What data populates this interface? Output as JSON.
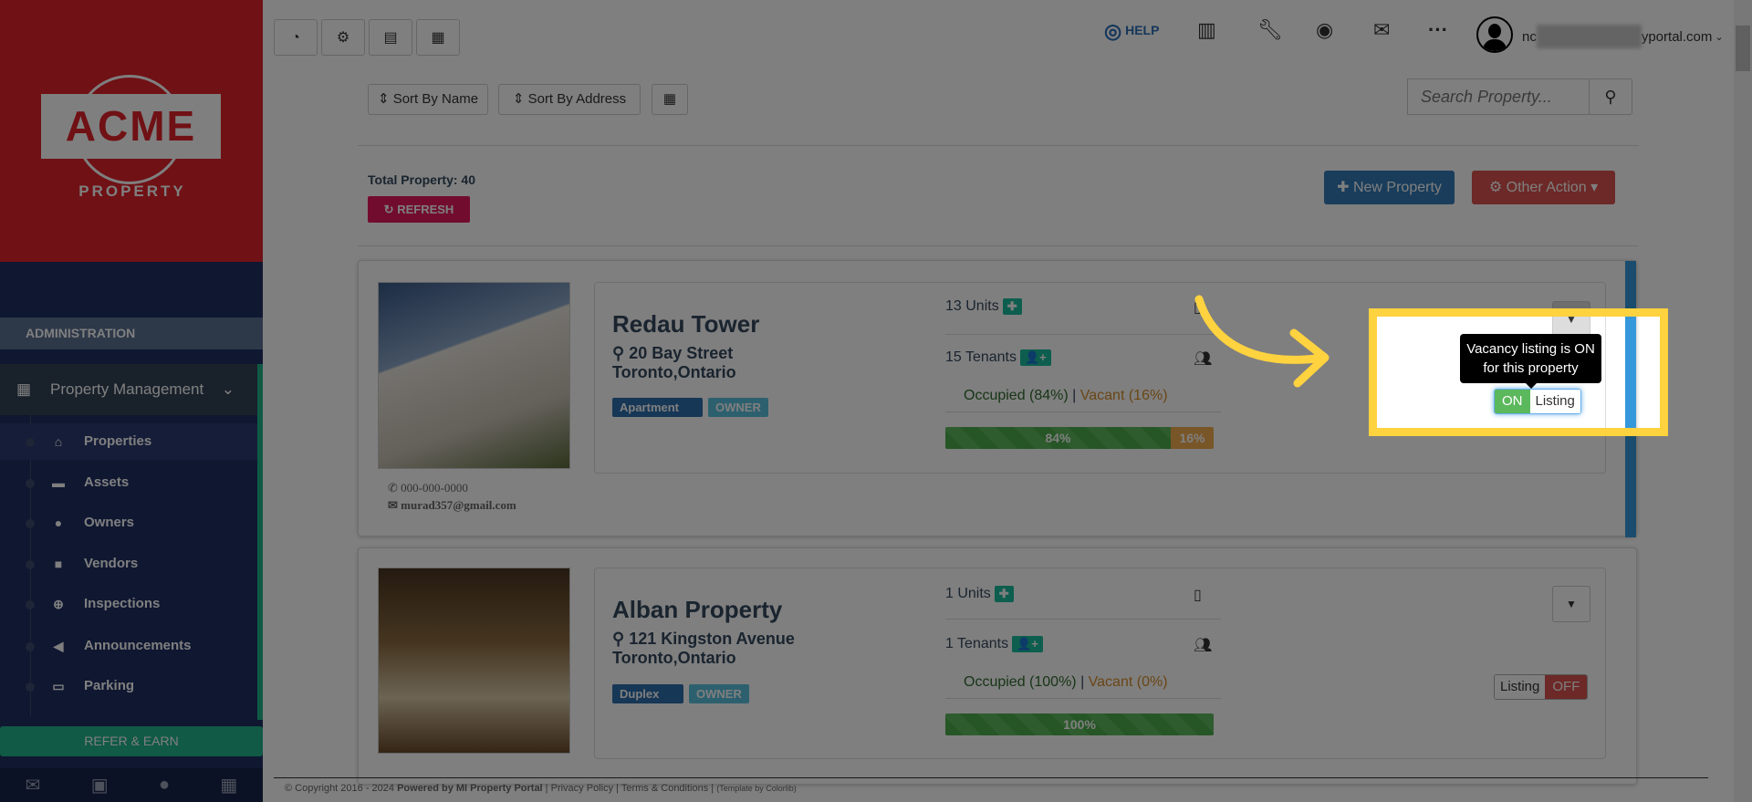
{
  "sidebar": {
    "logo_text": "ACME",
    "logo_sub": "PROPERTY",
    "section": "ADMINISTRATION",
    "group": "Property Management",
    "items": [
      {
        "label": "Properties",
        "icon": "home-icon"
      },
      {
        "label": "Assets",
        "icon": "archive-icon"
      },
      {
        "label": "Owners",
        "icon": "user-icon"
      },
      {
        "label": "Vendors",
        "icon": "briefcase-icon"
      },
      {
        "label": "Inspections",
        "icon": "search-plus-icon"
      },
      {
        "label": "Announcements",
        "icon": "bullhorn-icon"
      },
      {
        "label": "Parking",
        "icon": "car-icon"
      }
    ],
    "refer": "REFER & EARN"
  },
  "topbar": {
    "help": "HELP",
    "user_email_start": "nc",
    "user_email_end": "yportal.com"
  },
  "toolbar": {
    "sort_name": "Sort By Name",
    "sort_address": "Sort By Address",
    "search_placeholder": "Search Property...",
    "total": "Total Property: 40",
    "refresh": "REFRESH",
    "new_property": "New Property",
    "other_action": "Other Action"
  },
  "properties": [
    {
      "name": "Redau Tower",
      "street": "20 Bay Street",
      "city": "Toronto,Ontario",
      "type": "Apartment",
      "role": "OWNER",
      "phone": "000-000-0000",
      "email": "murad357@gmail.com",
      "units": "13 Units",
      "tenants": "15 Tenants",
      "occupied": "Occupied (84%)",
      "vacant": "Vacant (16%)",
      "occupied_pct": 84,
      "vacant_pct": 16,
      "occ_label": "84%",
      "vac_label": "16%",
      "listing_state": "ON",
      "listing_label": "Listing",
      "tooltip": "Vacancy listing is ON for this property"
    },
    {
      "name": "Alban Property",
      "street": "121 Kingston Avenue",
      "city": "Toronto,Ontario",
      "type": "Duplex",
      "role": "OWNER",
      "units": "1 Units",
      "tenants": "1 Tenants",
      "occupied": "Occupied (100%)",
      "vacant": "Vacant (0%)",
      "occupied_pct": 100,
      "vacant_pct": 0,
      "occ_label": "100%",
      "listing_state": "OFF",
      "listing_label": "Listing"
    }
  ],
  "footer": {
    "copyright": "© Copyright 2016 - 2024",
    "powered": "Powered by MI Property Portal",
    "privacy": "Privacy Policy",
    "terms": "Terms & Conditions",
    "template": "(Template by Colorlib)"
  },
  "colors": {
    "accent": "#ffd23f",
    "success": "#5cb85c",
    "danger": "#d9534f",
    "primary": "#337ab7"
  }
}
